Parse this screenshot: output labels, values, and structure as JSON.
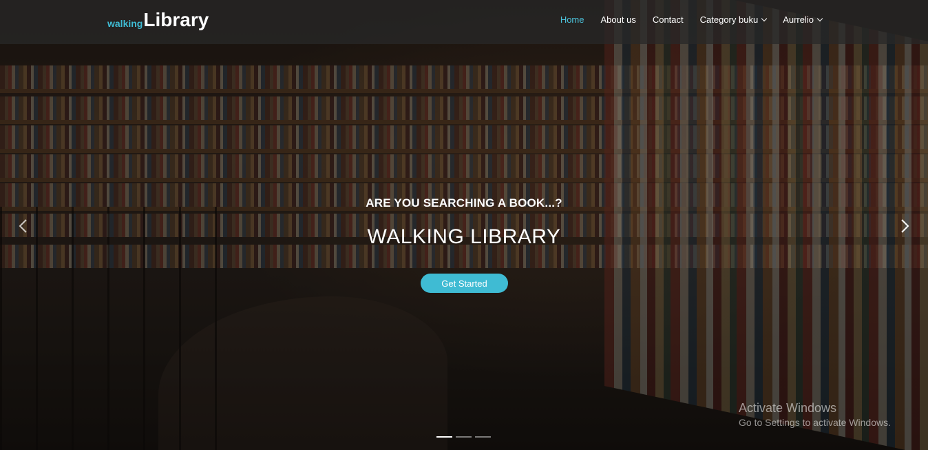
{
  "brand": {
    "small": "walking",
    "big": "Library"
  },
  "nav": [
    {
      "label": "Home",
      "active": true
    },
    {
      "label": "About us"
    },
    {
      "label": "Contact"
    },
    {
      "label": "Category buku",
      "dropdown": true
    },
    {
      "label": "Aurrelio",
      "dropdown": true
    }
  ],
  "hero": {
    "subtitle": "ARE YOU SEARCHING A BOOK...?",
    "title": "WALKING LIBRARY",
    "cta_label": "Get Started"
  },
  "carousel": {
    "slide_count": 3,
    "active_index": 0
  },
  "watermark": {
    "title": "Activate Windows",
    "subtitle": "Go to Settings to activate Windows."
  },
  "colors": {
    "accent": "#3fbbd3",
    "header_bg": "#282828"
  },
  "icons": [
    "chevron-down-icon",
    "chevron-left-icon",
    "chevron-right-icon"
  ]
}
